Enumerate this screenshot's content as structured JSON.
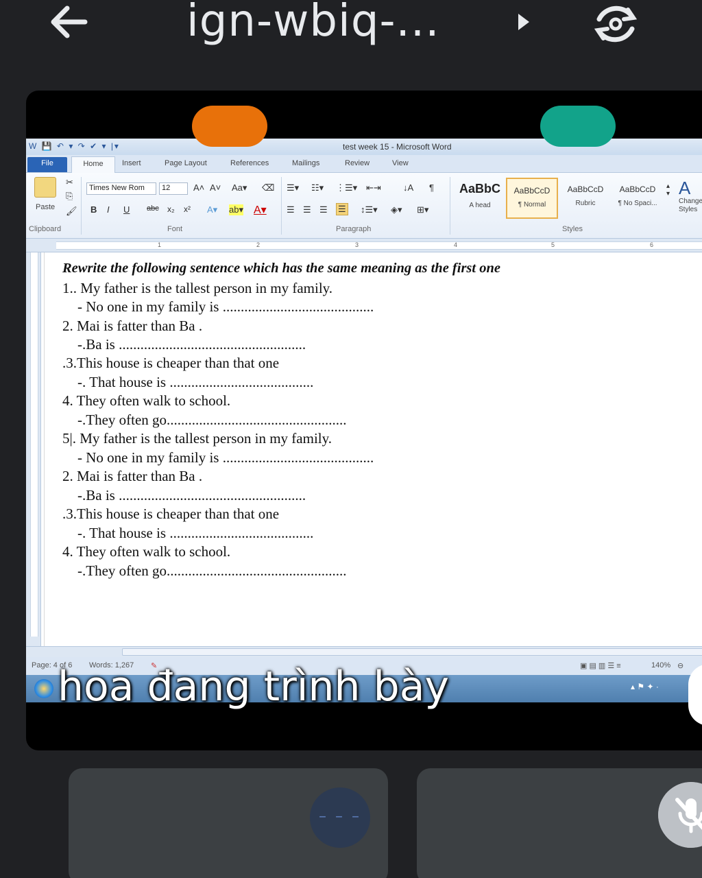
{
  "meet": {
    "title": "ign-wbiq-...",
    "subtitle": "hoa đang trình bày"
  },
  "word": {
    "qat": "W 💾 ↶ ▾ ↷ ✔ ▾ |▾",
    "doc_title": "test week 15 - Microsoft Word",
    "tabs": [
      "File",
      "Home",
      "Insert",
      "Page Layout",
      "References",
      "Mailings",
      "Review",
      "View"
    ],
    "ribbon": {
      "paste": "Paste",
      "clipboard": "Clipboard",
      "font_name": "Times New Rom",
      "font_size": "12",
      "font_group": "Font",
      "paragraph_group": "Paragraph",
      "styles_group": "Styles",
      "styles": [
        {
          "sample": "AaBbC",
          "name": "A head"
        },
        {
          "sample": "AaBbCcD",
          "name": "¶ Normal"
        },
        {
          "sample": "AaBbCcD",
          "name": "Rubric"
        },
        {
          "sample": "AaBbCcD",
          "name": "¶ No Spaci..."
        }
      ],
      "change_styles": "Change Styles"
    },
    "document": {
      "heading": "Rewrite the following  sentence which has the same meaning as the first one",
      "lines": [
        "1.. My father is the tallest person in my family.",
        "  - No one in my family is ..........................................",
        "2. Mai is fatter than Ba .",
        "     -.Ba is  ....................................................",
        ".3.This house is cheaper than that one",
        "     -. That house is ........................................",
        "4. They often walk to school.",
        "     -.They often go..................................................",
        "5|. My father is the tallest person in my family.",
        "  - No one in my family is ..........................................",
        "2. Mai is fatter than Ba .",
        "     -.Ba is  ....................................................",
        ".3.This house is cheaper than that one",
        "     -. That house is ........................................",
        "4. They often walk to school.",
        "     -.They often go.................................................."
      ]
    },
    "status": {
      "page": "Page: 4 of 6",
      "words": "Words: 1,267",
      "zoom": "140%"
    }
  }
}
